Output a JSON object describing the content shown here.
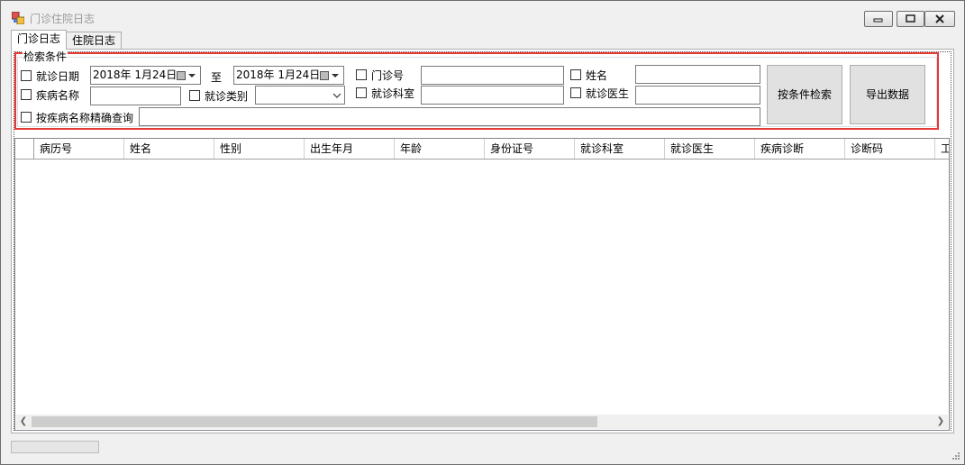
{
  "window": {
    "title": "门诊住院日志",
    "minimize_icon": "minimize-icon",
    "maximize_icon": "maximize-icon",
    "close_icon": "close-icon"
  },
  "tabs": [
    {
      "label": "门诊日志",
      "active": true
    },
    {
      "label": "住院日志",
      "active": false
    }
  ],
  "search_group": {
    "title": "检索条件",
    "visit_date_label": "就诊日期",
    "date_from": "2018年  1月24日",
    "date_to_separator": "至",
    "date_to": "2018年  1月24日",
    "outpatient_no_label": "门诊号",
    "outpatient_no_value": "",
    "name_label": "姓名",
    "name_value": "",
    "disease_name_label": "疾病名称",
    "disease_name_value": "",
    "visit_type_label": "就诊类别",
    "visit_type_value": "",
    "department_label": "就诊科室",
    "department_value": "",
    "doctor_label": "就诊医生",
    "doctor_value": "",
    "exact_disease_label": "按疾病名称精确查询",
    "exact_disease_value": "",
    "search_button": "按条件检索",
    "export_button": "导出数据"
  },
  "table": {
    "columns": [
      "病历号",
      "姓名",
      "性别",
      "出生年月",
      "年龄",
      "身份证号",
      "就诊科室",
      "就诊医生",
      "疾病诊断",
      "诊断码",
      "工"
    ],
    "rows": []
  },
  "colors": {
    "highlight_border": "#e53935",
    "window_bg": "#f0f0f0",
    "title_text": "#9a9a9a"
  }
}
